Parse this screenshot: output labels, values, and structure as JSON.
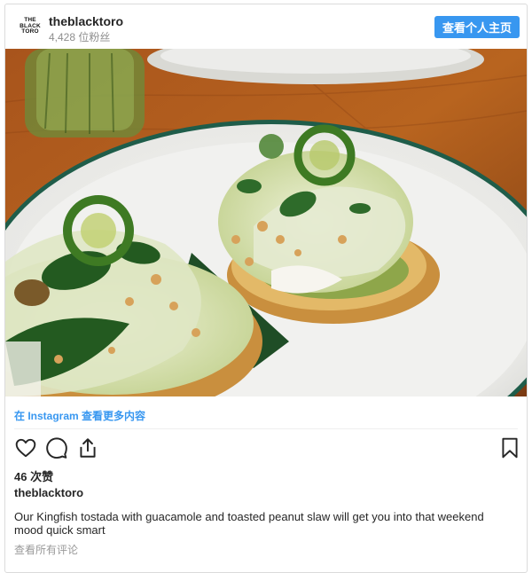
{
  "header": {
    "avatar_text": "THE\nBLACK\nTORO",
    "username": "theblacktoro",
    "followers": "4,428 位粉丝",
    "profile_button": "查看个人主页"
  },
  "post": {
    "instagram_link": "在 Instagram 查看更多内容",
    "likes": "46 次赞",
    "caption_user": "theblacktoro",
    "caption": "Our Kingfish tostada with guacamole and toasted peanut slaw will get you into that weekend mood quick smart",
    "view_comments": "查看所有评论"
  },
  "icons": {
    "like": "heart-icon",
    "comment": "comment-icon",
    "share": "share-icon",
    "save": "bookmark-icon"
  },
  "colors": {
    "accent": "#3897f0",
    "text": "#262626",
    "muted": "#8e8e8e"
  }
}
